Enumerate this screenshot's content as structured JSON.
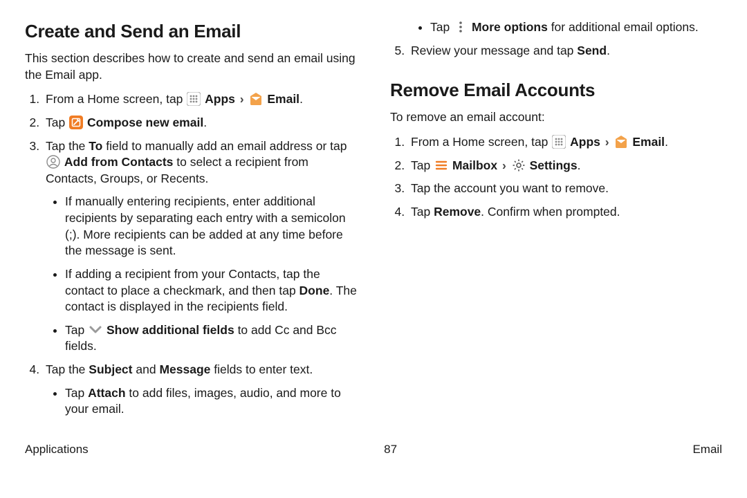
{
  "left": {
    "heading": "Create and Send an Email",
    "intro": "This section describes how to create and send an email using the Email app.",
    "step1_a": "From a Home screen, tap ",
    "apps": "Apps",
    "email": "Email",
    "step2_a": "Tap ",
    "compose": "Compose new email",
    "step3_a": "Tap the ",
    "to": "To",
    "step3_b": " field to manually add an email address or tap ",
    "add_from_contacts": "Add from Contacts",
    "step3_c": " to select a recipient from Contacts, Groups, or Recents.",
    "b1": "If manually entering recipients, enter additional recipients by separating each entry with a semicolon (;). More recipients can be added at any time before the message is sent.",
    "b2_a": "If adding a recipient from your Contacts, tap the contact to place a checkmark, and then tap ",
    "done": "Done",
    "b2_b": ". The contact is displayed in the recipients field.",
    "b3_a": "Tap ",
    "show_add": "Show additional fields",
    "b3_b": " to add Cc and Bcc fields."
  },
  "right": {
    "step4_a": "Tap the ",
    "subject": "Subject",
    "and": " and ",
    "message": "Message",
    "step4_b": " fields to enter text.",
    "b4a_a": "Tap ",
    "attach": "Attach",
    "b4a_b": " to add files, images, audio, and more to your email.",
    "b4b_a": "Tap ",
    "more_opt": "More options",
    "b4b_b": " for additional email options.",
    "step5_a": "Review your message and tap ",
    "send": "Send",
    "period": ".",
    "heading2": "Remove Email Accounts",
    "intro2": "To remove an email account:",
    "r1_a": "From a Home screen, tap ",
    "r2_a": "Tap ",
    "mailbox": "Mailbox",
    "settings": "Settings",
    "r3": "Tap the account you want to remove.",
    "r4_a": "Tap ",
    "remove": "Remove",
    "r4_b": ". Confirm when prompted."
  },
  "footer": {
    "left": "Applications",
    "center": "87",
    "right": "Email"
  }
}
